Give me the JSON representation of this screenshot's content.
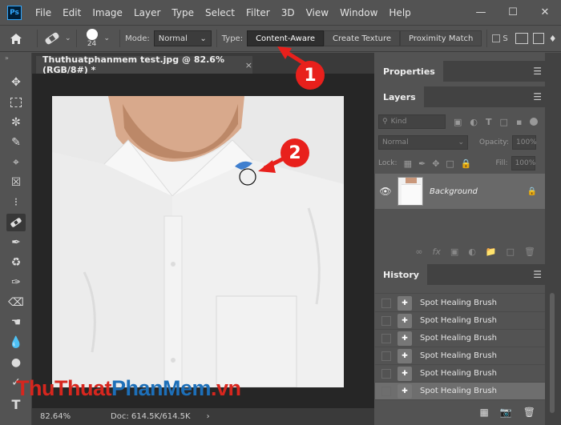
{
  "menu": {
    "logo": "Ps",
    "items": [
      "File",
      "Edit",
      "Image",
      "Layer",
      "Type",
      "Select",
      "Filter",
      "3D",
      "View",
      "Window",
      "Help"
    ],
    "window_controls": [
      "—",
      "☐",
      "✕"
    ]
  },
  "options": {
    "brush_size": "24",
    "mode_label": "Mode:",
    "mode_value": "Normal",
    "type_label": "Type:",
    "type_buttons": [
      "Content-Aware",
      "Create Texture",
      "Proximity Match"
    ],
    "sample_label": "S"
  },
  "document": {
    "tab_title": "Thuthuatphanmem test.jpg @ 82.6% (RGB/8#) *",
    "close_glyph": "×"
  },
  "status": {
    "zoom": "82.64%",
    "doc_size": "Doc: 614.5K/614.5K",
    "arrow": "›"
  },
  "properties": {
    "tab": "Properties"
  },
  "layers": {
    "tab": "Layers",
    "filter_kind": "Kind",
    "blend_mode": "Normal",
    "opacity_label": "Opacity:",
    "opacity_value": "100%",
    "lock_label": "Lock:",
    "fill_label": "Fill:",
    "fill_value": "100%",
    "layer_name": "Background"
  },
  "history": {
    "tab": "History",
    "items": [
      "Spot Healing Brush",
      "Spot Healing Brush",
      "Spot Healing Brush",
      "Spot Healing Brush",
      "Spot Healing Brush",
      "Spot Healing Brush"
    ]
  },
  "annotations": {
    "one": "1",
    "two": "2"
  },
  "watermark": {
    "part1": "Thu",
    "part2": "Thuat",
    "part3": "PhanMem",
    "part4": ".vn"
  },
  "colors": {
    "accent_red": "#e8201c",
    "ps_blue": "#31a8ff",
    "watermark_red": "#d7261e",
    "watermark_blue": "#1d6fb8"
  }
}
